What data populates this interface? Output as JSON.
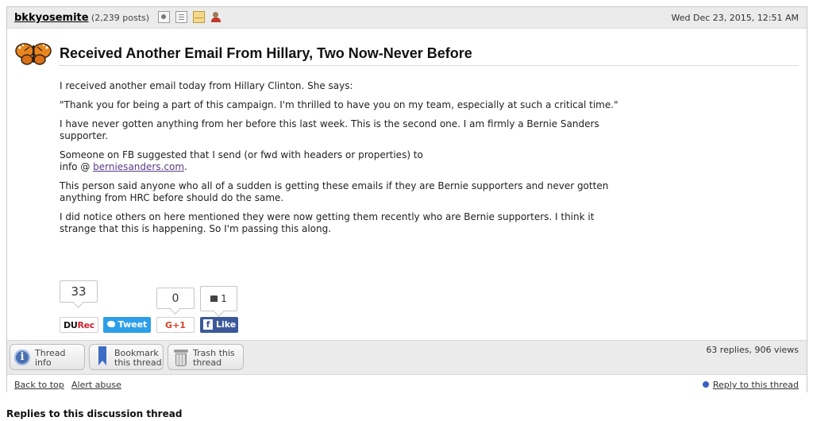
{
  "post": {
    "author": "bkkyosemite",
    "post_count": "(2,239 posts)",
    "header_icons": [
      "profile-icon",
      "journal-icon",
      "mail-icon",
      "ignore-user-icon"
    ],
    "date": "Wed Dec 23, 2015, 12:51 AM",
    "avatar": "butterfly-icon",
    "title": "Received Another Email From Hillary, Two Now-Never Before",
    "body": {
      "p1": "I received another email today from Hillary Clinton. She says:",
      "p2": "\"Thank you for being a part of this campaign. I'm thrilled to have you on my team, especially at such a critical time.\"",
      "p3_line1": "I have never gotten anything from her before this last week. This is the second one. I am firmly a Bernie Sanders",
      "p3_line2": "supporter.",
      "p4_line1": "Someone on FB suggested that I send (or fwd with headers or properties) to",
      "p4_prefix": "info @ ",
      "p4_link": "berniesanders.com",
      "p4_suffix": ".",
      "p5_line1": "This person said anyone who all of a sudden is getting these emails if they are Bernie supporters and never gotten",
      "p5_line2": "anything from HRC before should do the same.",
      "p6_line1": "I did notice others on here mentioned they were now getting them recently who are Bernie supporters. I think it",
      "p6_line2": "strange that this is happening. So I'm passing this along."
    }
  },
  "social": {
    "du_count": "33",
    "gplus_count": "0",
    "fb_count": "1",
    "du_label_a": "DU",
    "du_label_b": "Rec",
    "tweet_label": "Tweet",
    "gplus_label": "G+1",
    "fb_label": "Like",
    "fb_glyph": "f"
  },
  "footer": {
    "thread_info_1": "Thread",
    "thread_info_2": "info",
    "bookmark_1": "Bookmark",
    "bookmark_2": "this thread",
    "trash_1": "Trash this",
    "trash_2": "thread",
    "stats": "63 replies, 906 views"
  },
  "links": {
    "back_to_top": "Back to top",
    "alert_abuse": "Alert abuse",
    "reply": "Reply to this thread"
  },
  "replies_heading": "Replies to this discussion thread"
}
